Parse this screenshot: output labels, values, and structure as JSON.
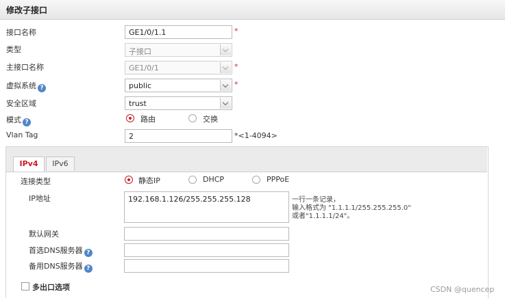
{
  "dialog": {
    "title": "修改子接口"
  },
  "form": {
    "interface_name": {
      "label": "接口名称",
      "value": "GE1/0/1.1",
      "required": "*"
    },
    "type": {
      "label": "类型",
      "value": "子接口"
    },
    "main_interface": {
      "label": "主接口名称",
      "value": "GE1/0/1",
      "required": "*"
    },
    "virtual_system": {
      "label": "虚拟系统",
      "help": "?",
      "value": "public",
      "required": "*"
    },
    "security_zone": {
      "label": "安全区域",
      "value": "trust"
    },
    "mode": {
      "label": "模式",
      "help": "?",
      "options": [
        "路由",
        "交换"
      ],
      "selected": "路由"
    },
    "vlan_tag": {
      "label": "Vlan Tag",
      "value": "2",
      "hint": "*<1-4094>"
    }
  },
  "tabs": [
    {
      "label": "IPv4",
      "active": true
    },
    {
      "label": "IPv6",
      "active": false
    }
  ],
  "ipv4": {
    "connection_type": {
      "label": "连接类型",
      "options": [
        "静态IP",
        "DHCP",
        "PPPoE"
      ],
      "selected": "静态IP"
    },
    "ip_address": {
      "label": "IP地址",
      "value": "192.168.1.126/255.255.255.128",
      "hint_lines": [
        "一行一条记录，",
        "输入格式为 \"1.1.1.1/255.255.255.0\"",
        "或者\"1.1.1.1/24\"。"
      ]
    },
    "default_gateway": {
      "label": "默认网关",
      "value": ""
    },
    "preferred_dns": {
      "label": "首选DNS服务器",
      "help": "?",
      "value": ""
    },
    "backup_dns": {
      "label": "备用DNS服务器",
      "help": "?",
      "value": ""
    },
    "multi_exit": {
      "label": "多出口选项",
      "checked": false
    }
  },
  "watermark": "CSDN @quencep",
  "colors": {
    "accent_red": "#c61d23",
    "required_red": "#d9262b",
    "help_blue": "#4f86c6"
  }
}
